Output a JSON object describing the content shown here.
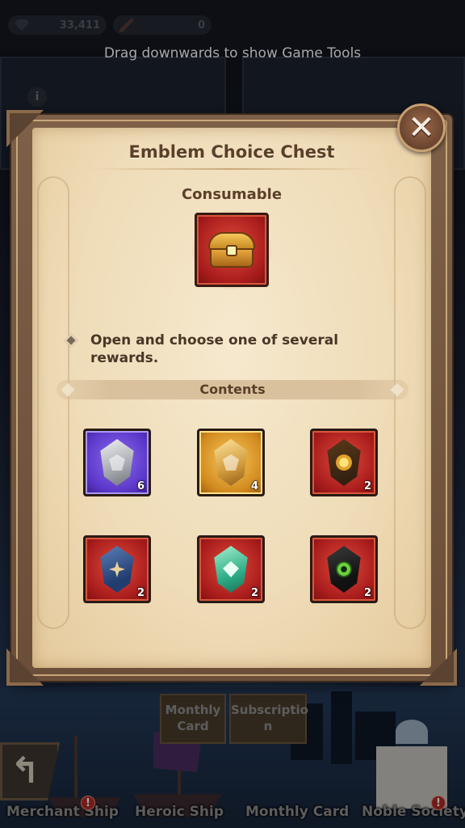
{
  "topbar": {
    "gem_count": "33,411",
    "quill_count": "0"
  },
  "hint": "Drag downwards to show Game Tools",
  "background": {
    "signboards": [
      "Monthly Card",
      "Subscriptio n"
    ],
    "bottom_labels": [
      "Merchant Ship",
      "Heroic Ship",
      "Monthly Card",
      "Noble Society"
    ],
    "alert_glyph": "!"
  },
  "modal": {
    "title": "Emblem Choice Chest",
    "subtitle": "Consumable",
    "chest_icon": "treasure-chest-icon",
    "description": "Open and choose one of several rewards.",
    "contents_label": "Contents",
    "close_glyph": "✕",
    "items": [
      {
        "icon": "silver-emblem-icon",
        "frame": "purple",
        "count": "6"
      },
      {
        "icon": "gold-emblem-icon",
        "frame": "gold",
        "count": "4"
      },
      {
        "icon": "sun-emblem-icon",
        "frame": "red",
        "count": "2"
      },
      {
        "icon": "star-emblem-icon",
        "frame": "red",
        "count": "2"
      },
      {
        "icon": "leaf-emblem-icon",
        "frame": "red",
        "count": "2"
      },
      {
        "icon": "eye-emblem-icon",
        "frame": "red",
        "count": "2"
      }
    ]
  },
  "colors": {
    "parchment": "#efdcb8",
    "frame_brown": "#6b4e39",
    "title_text": "#5a3f29",
    "rarity_purple": "#5a36c8",
    "rarity_gold": "#d28a1f",
    "rarity_red": "#a81c1c"
  }
}
